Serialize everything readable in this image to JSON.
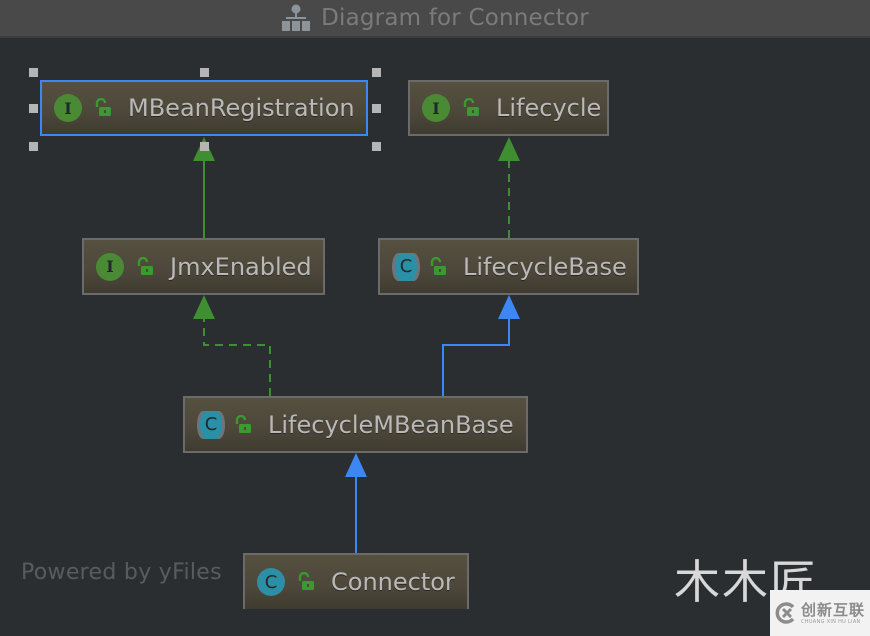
{
  "window": {
    "title": "Diagram for Connector",
    "title_icon": "hierarchy-diagram-icon"
  },
  "colors": {
    "interface_icon": "#4a8a35",
    "class_icon": "#2b8fa6",
    "implements_edge": "#3f8e32",
    "extends_edge": "#3d87f5",
    "selection": "#3d87f5",
    "node_fill": "#4f4a3c",
    "canvas": "#2b2e31"
  },
  "nodes": [
    {
      "id": "mbeanregistration",
      "name": "MBeanRegistration",
      "kind": "interface",
      "kind_letter": "I",
      "visibility": "public",
      "selected": true
    },
    {
      "id": "lifecycle",
      "name": "Lifecycle",
      "kind": "interface",
      "kind_letter": "I",
      "visibility": "public",
      "selected": false
    },
    {
      "id": "jmxenabled",
      "name": "JmxEnabled",
      "kind": "interface",
      "kind_letter": "I",
      "visibility": "public",
      "selected": false
    },
    {
      "id": "lifecyclebase",
      "name": "LifecycleBase",
      "kind": "abstract-class",
      "kind_letter": "C",
      "visibility": "public",
      "selected": false
    },
    {
      "id": "lifecyclembeanbase",
      "name": "LifecycleMBeanBase",
      "kind": "abstract-class",
      "kind_letter": "C",
      "visibility": "public",
      "selected": false
    },
    {
      "id": "connector",
      "name": "Connector",
      "kind": "class",
      "kind_letter": "C",
      "visibility": "public",
      "selected": false
    }
  ],
  "edges": [
    {
      "from": "jmxenabled",
      "to": "mbeanregistration",
      "type": "extends-interface",
      "style": "solid",
      "color": "green"
    },
    {
      "from": "lifecyclebase",
      "to": "lifecycle",
      "type": "implements",
      "style": "dashed",
      "color": "green"
    },
    {
      "from": "lifecyclembeanbase",
      "to": "jmxenabled",
      "type": "implements",
      "style": "dashed",
      "color": "green"
    },
    {
      "from": "lifecyclembeanbase",
      "to": "lifecyclebase",
      "type": "extends",
      "style": "solid",
      "color": "blue"
    },
    {
      "from": "connector",
      "to": "lifecyclembeanbase",
      "type": "extends",
      "style": "solid",
      "color": "blue"
    }
  ],
  "footer": {
    "powered_by": "Powered by yFiles"
  },
  "watermark": {
    "text": "木木匠",
    "brand_cn": "创新互联",
    "brand_en": "CHUANG XIN HU LIAN"
  }
}
